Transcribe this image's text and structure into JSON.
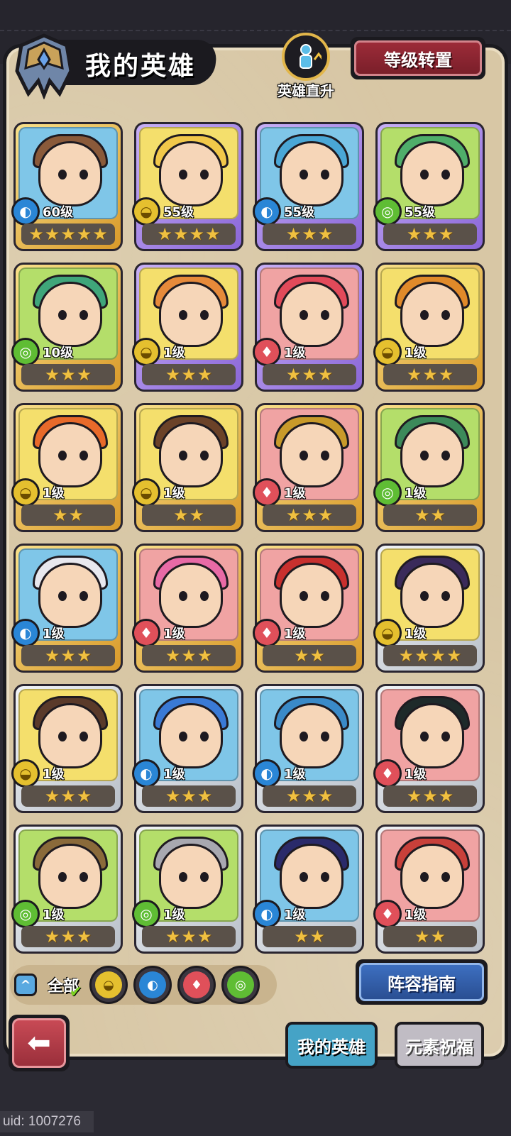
{
  "header": {
    "title": "我的英雄",
    "boost_label": "英雄直升",
    "level_reset_label": "等级转置"
  },
  "heroes": [
    {
      "level": "60级",
      "element": "water",
      "stars": 5,
      "frame": "gold",
      "bg": "blue"
    },
    {
      "level": "55级",
      "element": "earth",
      "stars": 4,
      "frame": "purple",
      "bg": "yellow"
    },
    {
      "level": "55级",
      "element": "water",
      "stars": 3,
      "frame": "purple",
      "bg": "blue"
    },
    {
      "level": "55级",
      "element": "wind",
      "stars": 3,
      "frame": "purple",
      "bg": "green"
    },
    {
      "level": "10级",
      "element": "wind",
      "stars": 3,
      "frame": "gold",
      "bg": "green"
    },
    {
      "level": "1级",
      "element": "earth",
      "stars": 3,
      "frame": "purple",
      "bg": "yellow"
    },
    {
      "level": "1级",
      "element": "fire",
      "stars": 3,
      "frame": "purple",
      "bg": "pink"
    },
    {
      "level": "1级",
      "element": "earth",
      "stars": 3,
      "frame": "gold",
      "bg": "yellow"
    },
    {
      "level": "1级",
      "element": "earth",
      "stars": 2,
      "frame": "gold",
      "bg": "yellow"
    },
    {
      "level": "1级",
      "element": "earth",
      "stars": 2,
      "frame": "gold",
      "bg": "yellow"
    },
    {
      "level": "1级",
      "element": "fire",
      "stars": 3,
      "frame": "gold",
      "bg": "pink"
    },
    {
      "level": "1级",
      "element": "wind",
      "stars": 2,
      "frame": "gold",
      "bg": "green"
    },
    {
      "level": "1级",
      "element": "water",
      "stars": 3,
      "frame": "gold",
      "bg": "blue"
    },
    {
      "level": "1级",
      "element": "fire",
      "stars": 3,
      "frame": "gold",
      "bg": "pink"
    },
    {
      "level": "1级",
      "element": "fire",
      "stars": 2,
      "frame": "gold",
      "bg": "pink"
    },
    {
      "level": "1级",
      "element": "earth",
      "stars": 4,
      "frame": "silver",
      "bg": "yellow"
    },
    {
      "level": "1级",
      "element": "earth",
      "stars": 3,
      "frame": "silver",
      "bg": "yellow"
    },
    {
      "level": "1级",
      "element": "water",
      "stars": 3,
      "frame": "silver",
      "bg": "blue"
    },
    {
      "level": "1级",
      "element": "water",
      "stars": 3,
      "frame": "silver",
      "bg": "blue"
    },
    {
      "level": "1级",
      "element": "fire",
      "stars": 3,
      "frame": "silver",
      "bg": "pink"
    },
    {
      "level": "1级",
      "element": "wind",
      "stars": 3,
      "frame": "silver",
      "bg": "green"
    },
    {
      "level": "1级",
      "element": "wind",
      "stars": 3,
      "frame": "silver",
      "bg": "green"
    },
    {
      "level": "1级",
      "element": "water",
      "stars": 2,
      "frame": "silver",
      "bg": "blue"
    },
    {
      "level": "1级",
      "element": "fire",
      "stars": 2,
      "frame": "silver",
      "bg": "pink"
    }
  ],
  "elements": {
    "water": {
      "icon": "water-drop-icon",
      "glyph": "◐",
      "color": "#2a86d6"
    },
    "earth": {
      "icon": "earth-swirl-icon",
      "glyph": "◒",
      "color": "#e5c02f"
    },
    "fire": {
      "icon": "fire-icon",
      "glyph": "♦",
      "color": "#e0505a"
    },
    "wind": {
      "icon": "wind-swirl-icon",
      "glyph": "◎",
      "color": "#5fbd34"
    }
  },
  "filters": {
    "all_label": "全部",
    "options": [
      "earth",
      "water",
      "fire",
      "wind"
    ]
  },
  "guide_label": "阵容指南",
  "tabs": {
    "my_heroes": "我的英雄",
    "element_blessing": "元素祝福"
  },
  "uid_text": "uid: 1007276",
  "colors": {
    "panel": "#d8c7a5",
    "gold_frame": "#d99a2a",
    "purple_frame": "#8a66d8",
    "silver_frame": "#b9c0c9",
    "red_button": "#9c2b38",
    "blue_button": "#3d6fc0"
  }
}
